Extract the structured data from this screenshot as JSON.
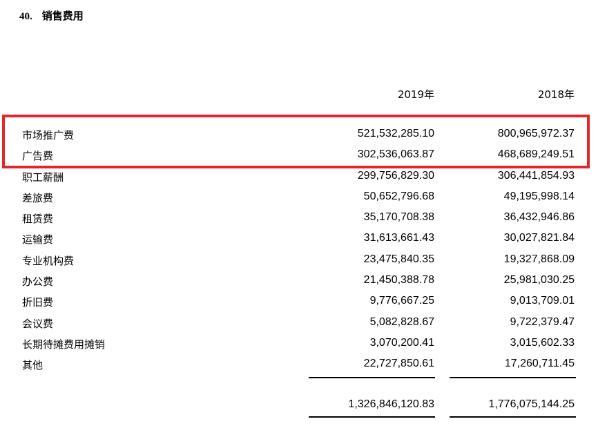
{
  "heading": {
    "number": "40.",
    "title": "销售费用"
  },
  "columns": [
    "2019年",
    "2018年"
  ],
  "rows": [
    {
      "label": "市场推广费",
      "y2019": "521,532,285.10",
      "y2018": "800,965,972.37"
    },
    {
      "label": "广告费",
      "y2019": "302,536,063.87",
      "y2018": "468,689,249.51"
    },
    {
      "label": "职工薪酬",
      "y2019": "299,756,829.30",
      "y2018": "306,441,854.93"
    },
    {
      "label": "差旅费",
      "y2019": "50,652,796.68",
      "y2018": "49,195,998.14"
    },
    {
      "label": "租赁费",
      "y2019": "35,170,708.38",
      "y2018": "36,432,946.86"
    },
    {
      "label": "运输费",
      "y2019": "31,613,661.43",
      "y2018": "30,027,821.84"
    },
    {
      "label": "专业机构费",
      "y2019": "23,475,840.35",
      "y2018": "19,327,868.09"
    },
    {
      "label": "办公费",
      "y2019": "21,450,388.78",
      "y2018": "25,981,030.25"
    },
    {
      "label": "折旧费",
      "y2019": "9,776,667.25",
      "y2018": "9,013,709.01"
    },
    {
      "label": "会议费",
      "y2019": "5,082,828.67",
      "y2018": "9,722,379.47"
    },
    {
      "label": "长期待摊费用摊销",
      "y2019": "3,070,200.41",
      "y2018": "3,015,602.33"
    },
    {
      "label": "其他",
      "y2019": "22,727,850.61",
      "y2018": "17,260,711.45"
    }
  ],
  "total": {
    "y2019": "1,326,846,120.83",
    "y2018": "1,776,075,144.25"
  },
  "highlight_color": "#e3262c"
}
